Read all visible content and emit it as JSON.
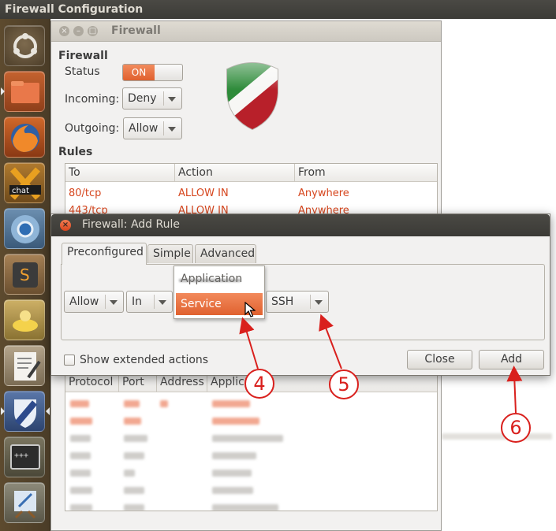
{
  "top_panel": {
    "title": "Firewall Configuration"
  },
  "launcher": {
    "items": [
      {
        "name": "dash-home-icon"
      },
      {
        "name": "files-icon"
      },
      {
        "name": "firefox-icon"
      },
      {
        "name": "xchat-icon"
      },
      {
        "name": "chromium-icon"
      },
      {
        "name": "sublime-text-icon"
      },
      {
        "name": "genie-lamp-icon"
      },
      {
        "name": "text-editor-icon"
      },
      {
        "name": "firewall-shield-icon"
      },
      {
        "name": "terminal-icon"
      },
      {
        "name": "drawing-app-icon"
      }
    ]
  },
  "main_window": {
    "title": "Firewall",
    "section_firewall": "Firewall",
    "status_label": "Status",
    "status_value": "ON",
    "incoming_label": "Incoming:",
    "incoming_value": "Deny",
    "outgoing_label": "Outgoing:",
    "outgoing_value": "Allow",
    "section_rules": "Rules",
    "rules_table": {
      "headers": [
        "To",
        "Action",
        "From"
      ],
      "rows": [
        [
          "80/tcp",
          "ALLOW IN",
          "Anywhere"
        ],
        [
          "443/tcp",
          "ALLOW IN",
          "Anywhere"
        ]
      ]
    },
    "bottom_table": {
      "headers": [
        "Protocol",
        "Port",
        "Address",
        "Applic"
      ]
    }
  },
  "dialog": {
    "title": "Firewall: Add Rule",
    "tabs": [
      "Preconfigured",
      "Simple",
      "Advanced"
    ],
    "active_tab": "Preconfigured",
    "policy_value": "Allow",
    "direction_value": "In",
    "category_menu": {
      "options": [
        "Application",
        "Service"
      ],
      "selected": "Service"
    },
    "service_value": "SSH",
    "show_extended_label": "Show extended actions",
    "close_label": "Close",
    "add_label": "Add"
  },
  "callouts": [
    "4",
    "5",
    "6"
  ],
  "colors": {
    "accent_orange": "#e0612f",
    "callout_red": "#d9201d",
    "rule_text": "#d6461e"
  }
}
